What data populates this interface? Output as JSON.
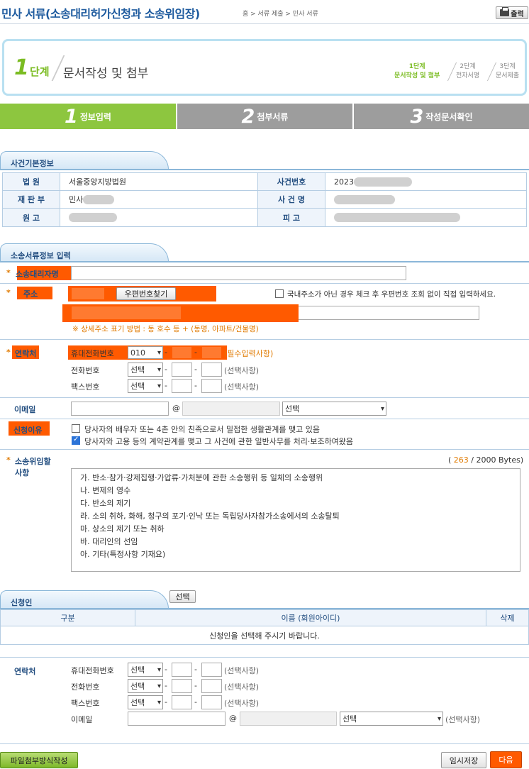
{
  "header": {
    "title": "민사 서류(소송대리허가신청과 소송위임장)",
    "breadcrumb": "홈 > 서류 제출 > 민사 서류",
    "print_label": "출력"
  },
  "step_box": {
    "num": "1",
    "num_label": "단계",
    "name": "문서작성 및 첨부",
    "mini_steps": [
      {
        "top": "1단계",
        "bottom": "문서작성 및 첨부"
      },
      {
        "top": "2단계",
        "bottom": "전자서명"
      },
      {
        "top": "3단계",
        "bottom": "문서제출"
      }
    ]
  },
  "tabs": [
    {
      "num": "1",
      "label": "정보입력"
    },
    {
      "num": "2",
      "label": "첨부서류"
    },
    {
      "num": "3",
      "label": "작성문서확인"
    }
  ],
  "case_info": {
    "section_title": "사건기본정보",
    "court_label": "법 원",
    "court_value": "서울중앙지방법원",
    "case_no_label": "사건번호",
    "case_no_prefix": "2023",
    "division_label": "재 판 부",
    "division_prefix": "민사",
    "case_name_label": "사 건 명",
    "plaintiff_label": "원 고",
    "defendant_label": "피 고"
  },
  "lit_info": {
    "section_title": "소송서류정보 입력",
    "agent_name_label": "소송대리자명",
    "address_label": "주소",
    "postcode_button": "우편번호찾기",
    "foreign_addr_note": "국내주소가 아닌 경우 체크 후 우편번호 조회 없이 직접 입력하세요.",
    "address_hint": "※ 상세주소 표기 방법 : 동 호수 등 + (동명, 아파트/건물명)",
    "contact_label": "연락처",
    "mobile_label": "휴대전화번호",
    "mobile_prefix": "010",
    "required_note": "(필수입력사항)",
    "phone_label": "전화번호",
    "fax_label": "팩스번호",
    "select_label": "선택",
    "optional_note": "(선택사항)",
    "email_label": "이메일",
    "at": "@",
    "reason_label": "신청이유",
    "reason_1": "당사자의 배우자 또는 4촌 안의 친족으로서 밀접한 생활관계를 맺고 있음",
    "reason_2": "당사자와 고용 등의 계약관계를 맺고 그 사건에 관한 일반사무를 처리·보조하여왔음",
    "delegation_label_1": "소송위임할",
    "delegation_label_2": "사항",
    "byte_open": "(",
    "byte_count": "263",
    "byte_total": "/ 2000 Bytes)",
    "delegation_lines": [
      "가. 반소·참가·강제집행·가압류·가처분에 관한 소송행위 등 일체의 소송행위",
      "나. 변제의 영수",
      "다. 반소의 제기",
      "라. 소의 취하, 화해, 청구의 포기·인낙 또는 독립당사자참가소송에서의 소송탈퇴",
      "마. 상소의 제기 또는 취하",
      "바. 대리인의 선임",
      "아. 기타(특정사항 기재요)"
    ]
  },
  "applicant": {
    "section_title": "신청인",
    "select_button": "선택",
    "col_type": "구분",
    "col_name": "이름 (회원아이디)",
    "col_delete": "삭제",
    "empty_msg": "신청인을 선택해 주시기 바랍니다.",
    "contact_label": "연락처",
    "mobile_label": "휴대전화번호",
    "phone_label": "전화번호",
    "fax_label": "팩스번호",
    "email_label": "이메일",
    "select_label": "선택",
    "optional_note": "(선택사항)",
    "at": "@"
  },
  "footer": {
    "file_attach_button": "파일첨부방식작성",
    "temp_save_button": "임시저장",
    "next_button": "다음"
  },
  "colors": {
    "accent_green": "#8dc63f",
    "tab_gray": "#9d9d9d",
    "highlight_orange": "#ff5a00",
    "heading_blue": "#1d5a9e"
  }
}
